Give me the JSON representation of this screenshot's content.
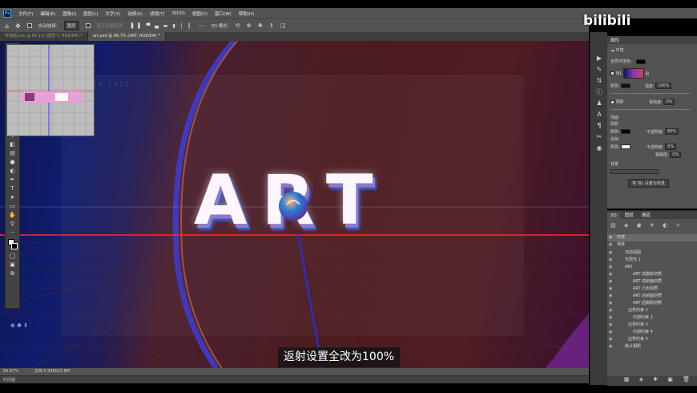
{
  "app": {
    "logo": "Ps"
  },
  "menu": [
    "文件(F)",
    "编辑(E)",
    "图像(I)",
    "图层(L)",
    "文字(Y)",
    "选择(S)",
    "滤镜(T)",
    "3D(D)",
    "视图(V)",
    "窗口(W)",
    "帮助(H)"
  ],
  "options_bar": {
    "auto_select_label": "自动选择:",
    "auto_select_value": "图层",
    "transform_label": "显示变换控件",
    "mode_label": "3D 模式:"
  },
  "tabs": [
    {
      "label": "环境图.psb @ 66.1% (图层 7, RGB/8#) *",
      "active": false
    },
    {
      "label": "art.psd @ 66.7% (ART, RGB/8#) *",
      "active": true
    }
  ],
  "canvas": {
    "art_text": "ART",
    "faint_year": "18 2021"
  },
  "status": {
    "zoom": "66.67%",
    "doc": "文档:5.93M/23.8M"
  },
  "timeline": {
    "label": "时间轴"
  },
  "properties": {
    "tab": "属性",
    "section": "环境",
    "global_env_color": "全局环境色：",
    "ibl": "IBL",
    "color": "颜色:",
    "intensity_label": "强度:",
    "intensity_value": "100%",
    "shadow": "阴影",
    "softness_label": "柔和度:",
    "softness_value": "0%",
    "ground": "地面",
    "ground_shadow": "阴影",
    "ground_color": "颜色:",
    "opacity_label": "不透明度:",
    "opacity_value": "60%",
    "reflection": "反射",
    "refl_opacity_label": "不透明度:",
    "refl_opacity_value": "0%",
    "roughness_label": "粗糙度:",
    "roughness_value": "0%",
    "bg": "背景",
    "bg_note": "",
    "set_bg_button": "将 IBL 设置为背景"
  },
  "layers_panel": {
    "tabs": [
      "3D",
      "图层",
      "通道"
    ],
    "rows": [
      {
        "label": "环境",
        "selected": true
      },
      {
        "label": "场景",
        "selected": false
      },
      {
        "label": "当前视图",
        "selected": false
      },
      {
        "label": "无限光 1",
        "selected": false
      },
      {
        "label": "ART",
        "selected": false
      },
      {
        "label": "ART 前膨胀材质",
        "selected": false
      },
      {
        "label": "ART 前斜面材质",
        "selected": false
      },
      {
        "label": "ART 凸出材质",
        "selected": false
      },
      {
        "label": "ART 后斜面材质",
        "selected": false
      },
      {
        "label": "ART 后膨胀材质",
        "selected": false
      },
      {
        "label": "边界约束 1",
        "selected": false
      },
      {
        "label": "内部约束 2",
        "selected": false
      },
      {
        "label": "边界约束 3",
        "selected": false
      },
      {
        "label": "内部约束 4",
        "selected": false
      },
      {
        "label": "边界约束 5",
        "selected": false
      },
      {
        "label": "默认相机",
        "selected": false
      }
    ]
  },
  "subtitle": "返射设置全改为100%",
  "watermark": "bilibili"
}
